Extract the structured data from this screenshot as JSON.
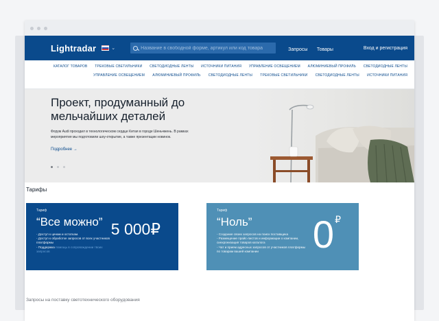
{
  "header": {
    "logo": "Lightradar",
    "search_placeholder": "Название в свободной форме, артикул или код товара",
    "nav": [
      "Запросы",
      "Товары"
    ],
    "login": "Вход и регистрация"
  },
  "categories": {
    "row1": [
      "КАТАЛОГ ТОВАРОВ",
      "ТРЕКОВЫЕ СВЕТИЛЬНИКИ",
      "СВЕТОДИОДНЫЕ ЛЕНТЫ",
      "ИСТОЧНИКИ ПИТАНИЯ",
      "УПРАВЛЕНИЕ ОСВЕЩЕНИЕМ",
      "АЛЮМИНИЕВЫЙ ПРОФИЛЬ",
      "СВЕТОДИОДНЫЕ ЛЕНТЫ"
    ],
    "row2": [
      "УПРАВЛЕНИЕ ОСВЕЩЕНИЕМ",
      "АЛЮМИНИЕВЫЙ ПРОФИЛЬ",
      "СВЕТОДИОДНЫЕ ЛЕНТЫ",
      "ТРЕКОВЫЕ СВЕТИЛЬНИКИ",
      "СВЕТОДИОДНЫЕ ЛЕНТЫ",
      "ИСТОЧНИКИ ПИТАНИЯ"
    ]
  },
  "hero": {
    "title": "Проект, продуманный до мельчайших деталей",
    "text": "Форум Audi проходил в технологическом сердце Китая в городе Шеньчжень. В рамках мероприятия мы подготовили шоу-открытие, а также презентации новинок.",
    "more": "Подробнее →"
  },
  "tariffs": {
    "title": "Тарифы",
    "cards": [
      {
        "label": "Тариф",
        "name": "“Все можно”",
        "price": "5 000₽",
        "features": [
          "- Доступ к ценам и остаткам.",
          "- Доступ к обработке запросов от всех участников платформы",
          "- Поддержка"
        ],
        "feature_highlight": "помощь в сопровождении твоих запросов"
      },
      {
        "label": "Тариф",
        "name": "“Ноль”",
        "price": "0",
        "currency": "₽",
        "features": [
          "- Создание своих запросов на поиск поставщика",
          "- Размещение прайс-листов и информации о компании, синхронизация товаров каталога",
          "- Чат и прием адресных запросов от участников платформы по товарам вашей компании"
        ]
      }
    ]
  },
  "bottom": "Запросы на поставку светотехнического оборудования"
}
